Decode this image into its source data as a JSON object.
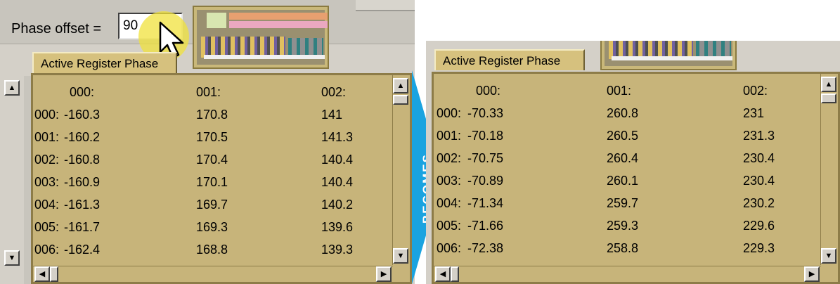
{
  "left": {
    "phase_label": "Phase offset =",
    "phase_value": "90",
    "tab_label": "Active Register Phase",
    "headers": [
      "000:",
      "001:",
      "002:"
    ],
    "rows": [
      {
        "label": "000:",
        "c0": "-160.3",
        "c1": "170.8",
        "c2": "141"
      },
      {
        "label": "001:",
        "c0": "-160.2",
        "c1": "170.5",
        "c2": "141.3"
      },
      {
        "label": "002:",
        "c0": "-160.8",
        "c1": "170.4",
        "c2": "140.4"
      },
      {
        "label": "003:",
        "c0": "-160.9",
        "c1": "170.1",
        "c2": "140.4"
      },
      {
        "label": "004:",
        "c0": "-161.3",
        "c1": "169.7",
        "c2": "140.2"
      },
      {
        "label": "005:",
        "c0": "-161.7",
        "c1": "169.3",
        "c2": "139.6"
      },
      {
        "label": "006:",
        "c0": "-162.4",
        "c1": "168.8",
        "c2": "139.3"
      }
    ]
  },
  "arrow_label": "BECOMES",
  "right": {
    "tab_label": "Active Register Phase",
    "headers": [
      "000:",
      "001:",
      "002:"
    ],
    "rows": [
      {
        "label": "000:",
        "c0": "-70.33",
        "c1": "260.8",
        "c2": "231"
      },
      {
        "label": "001:",
        "c0": "-70.18",
        "c1": "260.5",
        "c2": "231.3"
      },
      {
        "label": "002:",
        "c0": "-70.75",
        "c1": "260.4",
        "c2": "230.4"
      },
      {
        "label": "003:",
        "c0": "-70.89",
        "c1": "260.1",
        "c2": "230.4"
      },
      {
        "label": "004:",
        "c0": "-71.34",
        "c1": "259.7",
        "c2": "230.2"
      },
      {
        "label": "005:",
        "c0": "-71.66",
        "c1": "259.3",
        "c2": "229.6"
      },
      {
        "label": "006:",
        "c0": "-72.38",
        "c1": "258.8",
        "c2": "229.3"
      }
    ]
  },
  "icons": {
    "cursor": "mouse-pointer-icon",
    "scroll_up": "arrow-up-icon",
    "scroll_down": "arrow-down-icon",
    "scroll_left": "arrow-left-icon",
    "scroll_right": "arrow-right-icon"
  },
  "colors": {
    "table_bg": "#c7b47a",
    "arrow": "#1aa3e0",
    "highlight": "#f0e23c"
  }
}
